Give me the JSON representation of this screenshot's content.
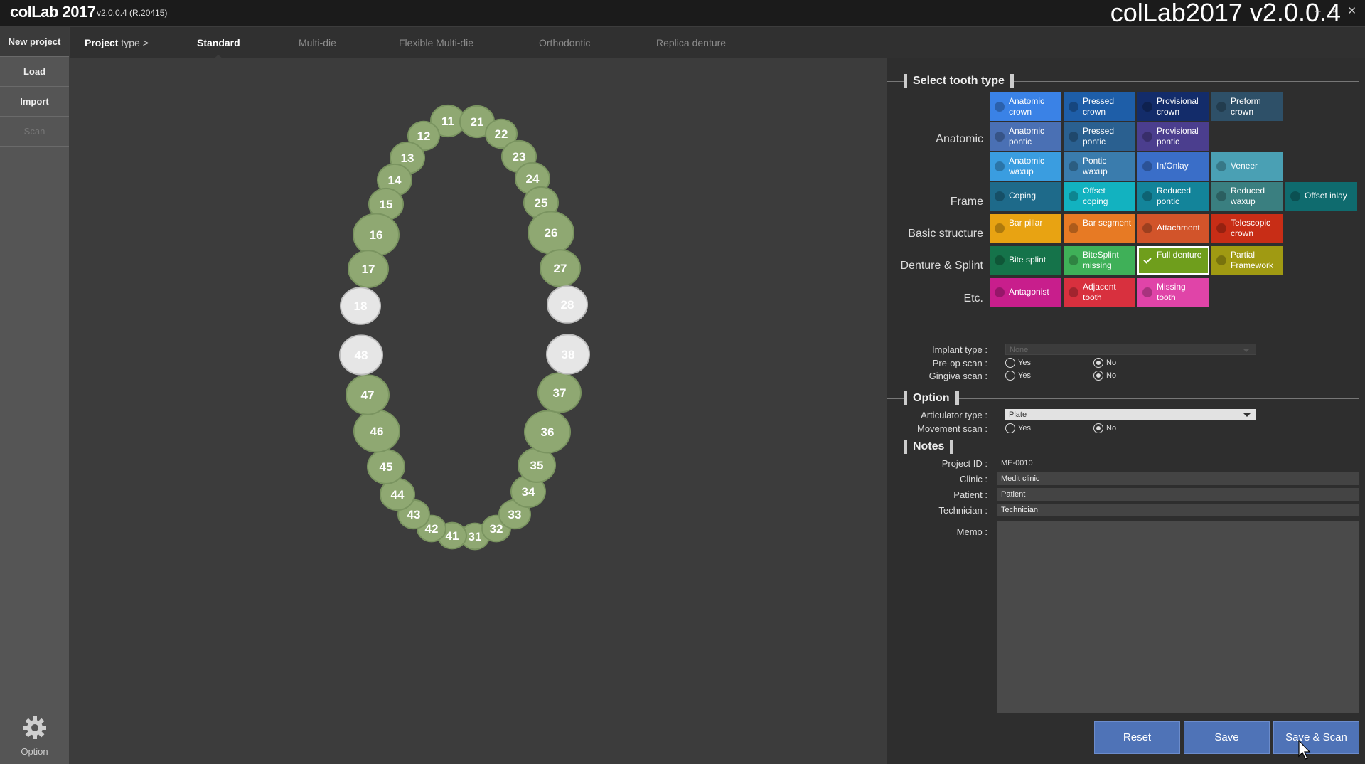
{
  "titlebar": {
    "logo": "colLab 2017",
    "version": "v2.0.0.4  (R.20415)",
    "overlay_title": "colLab2017 v2.0.0.4",
    "controls": "– ▫ ✕"
  },
  "sidebar": {
    "items": [
      {
        "label": "New project",
        "state": "active"
      },
      {
        "label": "Load",
        "state": "normal"
      },
      {
        "label": "Import",
        "state": "normal"
      },
      {
        "label": "Scan",
        "state": "disabled"
      }
    ],
    "option_label": "Option",
    "option_icon": "gear-icon"
  },
  "project_type": {
    "label_bold": "Project",
    "label_rest": " type >",
    "tabs": [
      {
        "label": "Standard",
        "active": true
      },
      {
        "label": "Multi-die",
        "active": false
      },
      {
        "label": "Flexible Multi-die",
        "active": false
      },
      {
        "label": "Orthodontic",
        "active": false
      },
      {
        "label": "Replica denture",
        "active": false
      }
    ]
  },
  "teeth": {
    "upper": [
      "11",
      "12",
      "13",
      "14",
      "15",
      "16",
      "17",
      "18",
      "21",
      "22",
      "23",
      "24",
      "25",
      "26",
      "27",
      "28"
    ],
    "lower": [
      "31",
      "32",
      "33",
      "34",
      "35",
      "36",
      "37",
      "38",
      "41",
      "42",
      "43",
      "44",
      "45",
      "46",
      "47",
      "48"
    ],
    "white": [
      "18",
      "28",
      "38",
      "48"
    ],
    "colors": {
      "normal": "#8fa872",
      "white": "#e6e6e6",
      "label": "#ffffff"
    }
  },
  "tooth_type": {
    "title": "Select tooth type",
    "groups": [
      {
        "label": "Anatomic",
        "rows": [
          [
            {
              "label": "Anatomic crown",
              "color": "#3a82e6"
            },
            {
              "label": "Pressed crown",
              "color": "#1e5ea8"
            },
            {
              "label": "Provisional crown",
              "color": "#132c6a"
            },
            {
              "label": "Preform crown",
              "color": "#2e5068"
            }
          ],
          [
            {
              "label": "Anatomic pontic",
              "color": "#4a70b4"
            },
            {
              "label": "Pressed pontic",
              "color": "#2a6090"
            },
            {
              "label": "Provisional pontic",
              "color": "#4b3e8e"
            }
          ],
          [
            {
              "label": "Anatomic waxup",
              "color": "#3a9de0"
            },
            {
              "label": "Pontic waxup",
              "color": "#3a7cad"
            },
            {
              "label": "In/Onlay",
              "color": "#3a6ec8"
            },
            {
              "label": "Veneer",
              "color": "#4aa0b4"
            }
          ]
        ]
      },
      {
        "label": "Frame",
        "rows": [
          [
            {
              "label": "Coping",
              "color": "#1e6a8a"
            },
            {
              "label": "Offset coping",
              "color": "#12b2c0"
            },
            {
              "label": "Reduced pontic",
              "color": "#13849a"
            },
            {
              "label": "Reduced waxup",
              "color": "#3a7f80"
            },
            {
              "label": "Offset inlay",
              "color": "#0f6b6e"
            }
          ]
        ]
      },
      {
        "label": "Basic structure",
        "rows": [
          [
            {
              "label": "Bar pillar",
              "color": "#e8a312"
            },
            {
              "label": "Bar segment",
              "color": "#e77a24"
            },
            {
              "label": "Attachment",
              "color": "#d2542a"
            },
            {
              "label": "Telescopic crown",
              "color": "#c82d16"
            }
          ]
        ]
      },
      {
        "label": "Denture & Splint",
        "rows": [
          [
            {
              "label": "Bite splint",
              "color": "#15734a"
            },
            {
              "label": "BiteSplint missing",
              "color": "#3fb058"
            },
            {
              "label": "Full denture",
              "color": "#6f9e1c",
              "selected": true
            },
            {
              "label": "Partial Framework",
              "color": "#a09a12"
            }
          ]
        ]
      },
      {
        "label": "Etc.",
        "rows": [
          [
            {
              "label": "Antagonist",
              "color": "#c81e8c"
            },
            {
              "label": "Adjacent tooth",
              "color": "#d8303e"
            },
            {
              "label": "Missing tooth",
              "color": "#e044a8"
            }
          ]
        ]
      }
    ]
  },
  "implant": {
    "implant_type_label": "Implant type :",
    "implant_type_value": "None",
    "preop_label": "Pre-op scan :",
    "gingiva_label": "Gingiva scan :",
    "yes": "Yes",
    "no": "No"
  },
  "option": {
    "title": "Option",
    "articulator_label": "Articulator type :",
    "articulator_value": "Plate",
    "movement_label": "Movement scan :",
    "yes": "Yes",
    "no": "No"
  },
  "notes": {
    "title": "Notes",
    "project_id_label": "Project ID :",
    "project_id": "ME-0010",
    "clinic_label": "Clinic :",
    "clinic": "Medit clinic",
    "patient_label": "Patient :",
    "patient": "Patient",
    "technician_label": "Technician :",
    "technician": "Technician",
    "memo_label": "Memo :"
  },
  "actions": {
    "reset": "Reset",
    "save": "Save",
    "save_scan": "Save & Scan",
    "color": "#4f73b7"
  }
}
